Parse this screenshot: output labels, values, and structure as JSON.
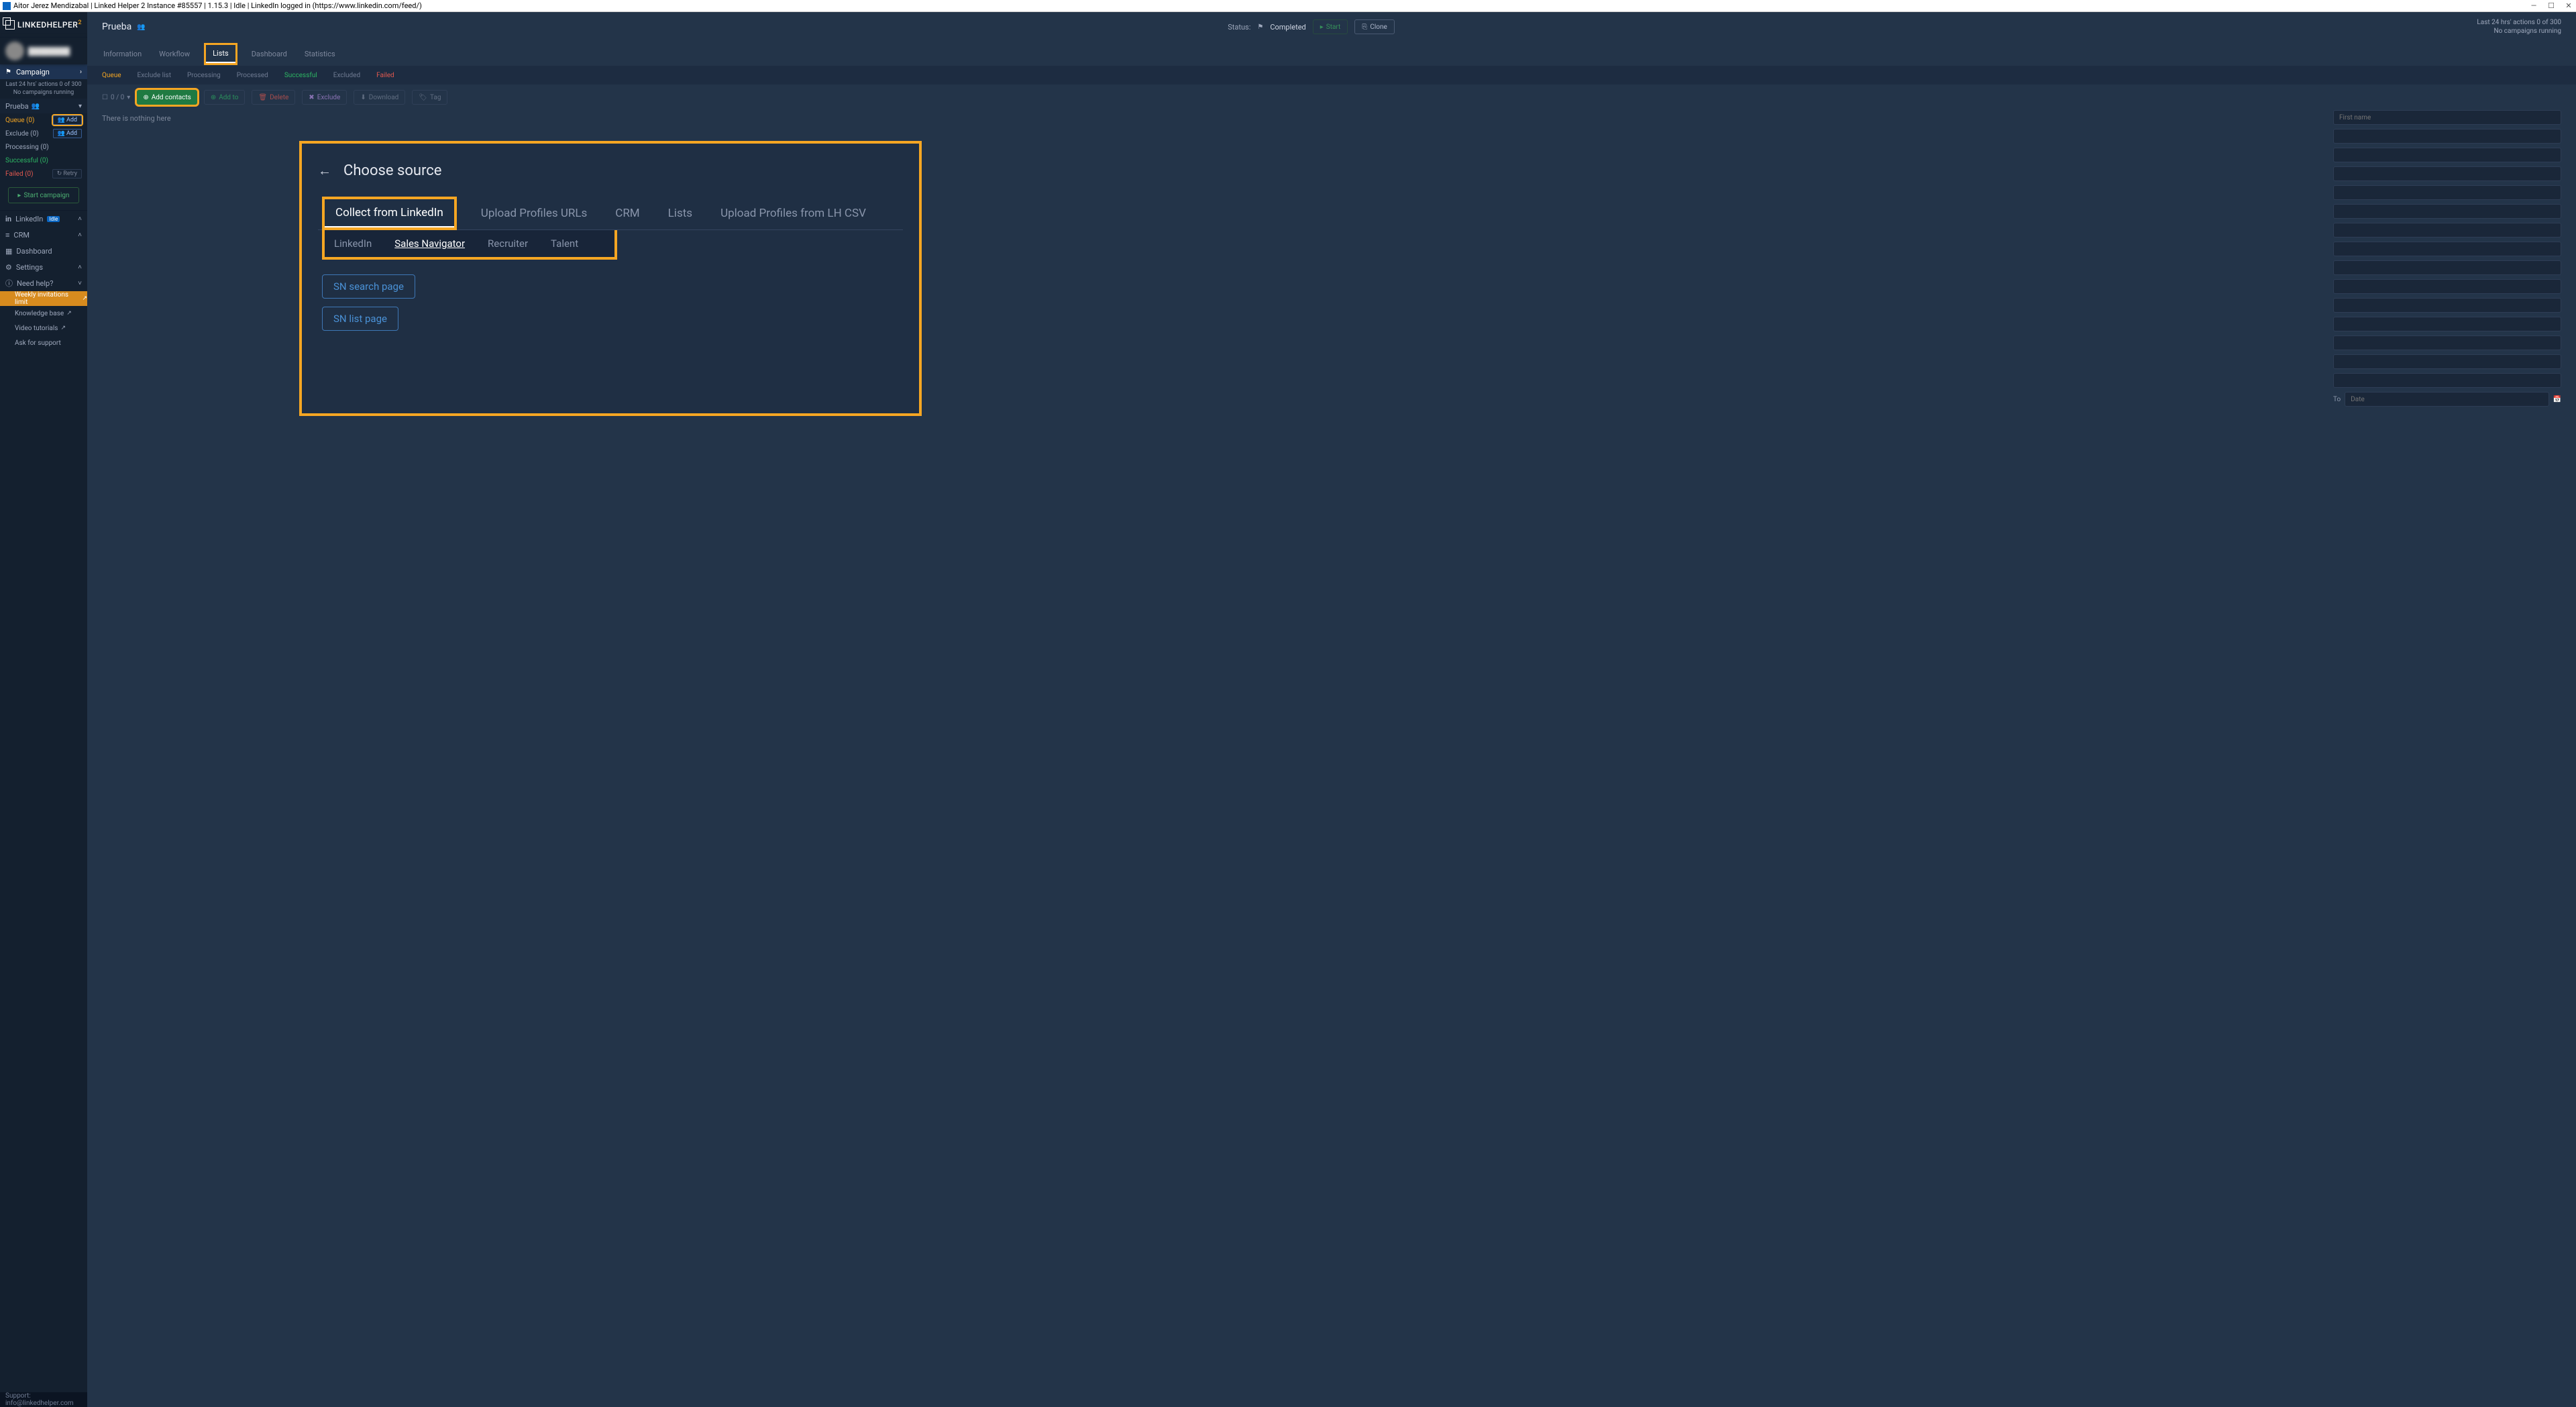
{
  "window_title": "Aitor Jerez Mendizabal | Linked Helper 2 Instance #85557 | 1.15.3 | Idle | LinkedIn logged in (https://www.linkedin.com/feed/)",
  "logo": {
    "text": "LINKEDHELPER",
    "sup": "2"
  },
  "sidebar": {
    "campaign_label": "Campaign",
    "stats_line1": "Last 24 hrs' actions 0 of 300",
    "stats_line2": "No campaigns running",
    "campaign_name": "Prueba",
    "statuses": [
      {
        "label": "Queue (0)",
        "cls": "q-queue",
        "btn": "Add",
        "btn_hl": true
      },
      {
        "label": "Exclude (0)",
        "cls": "",
        "btn": "Add",
        "btn_hl": false
      },
      {
        "label": "Processing (0)",
        "cls": "",
        "btn": "",
        "btn_hl": false
      },
      {
        "label": "Successful (0)",
        "cls": "q-success",
        "btn": "",
        "btn_hl": false
      },
      {
        "label": "Failed (0)",
        "cls": "q-fail",
        "btn": "Retry",
        "btn_hl": false
      }
    ],
    "start_campaign": "Start campaign",
    "linkedin": "LinkedIn",
    "linkedin_badge": "Idle",
    "crm": "CRM",
    "dashboard": "Dashboard",
    "settings": "Settings",
    "need_help": "Need help?",
    "help_items": [
      {
        "label": "Weekly invitations limit",
        "orange": true,
        "ext": true
      },
      {
        "label": "Knowledge base",
        "orange": false,
        "ext": true
      },
      {
        "label": "Video tutorials",
        "orange": false,
        "ext": true
      },
      {
        "label": "Ask for support",
        "orange": false,
        "ext": false
      }
    ]
  },
  "support_email": "Support: info@linkedhelper.com",
  "header": {
    "campaign_name": "Prueba",
    "status_label": "Status:",
    "status_value": "Completed",
    "start": "Start",
    "clone": "Clone",
    "right1": "Last 24 hrs' actions 0 of 300",
    "right2": "No campaigns running"
  },
  "tabs1": [
    "Information",
    "Workflow",
    "Lists",
    "Dashboard",
    "Statistics"
  ],
  "tabs1_active": 2,
  "subtabs": [
    {
      "label": "Queue",
      "cls": "queue"
    },
    {
      "label": "Exclude list",
      "cls": ""
    },
    {
      "label": "Processing",
      "cls": ""
    },
    {
      "label": "Processed",
      "cls": ""
    },
    {
      "label": "Successful",
      "cls": "success"
    },
    {
      "label": "Excluded",
      "cls": ""
    },
    {
      "label": "Failed",
      "cls": "fail"
    }
  ],
  "toolbar": {
    "count": "0 / 0",
    "add_contacts": "Add contacts",
    "add_to": "Add to",
    "delete": "Delete",
    "exclude": "Exclude",
    "download": "Download",
    "tag": "Tag"
  },
  "empty_text": "There is nothing here",
  "filter_placeholder": "First name",
  "to_label": "To",
  "date_placeholder": "Date",
  "modal": {
    "title": "Choose source",
    "mtabs": [
      "Collect from LinkedIn",
      "Upload Profiles URLs",
      "CRM",
      "Lists",
      "Upload Profiles from LH CSV"
    ],
    "srctabs": [
      "LinkedIn",
      "Sales Navigator",
      "Recruiter",
      "Talent"
    ],
    "srctabs_active": 1,
    "buttons": [
      "SN search page",
      "SN list page"
    ]
  }
}
